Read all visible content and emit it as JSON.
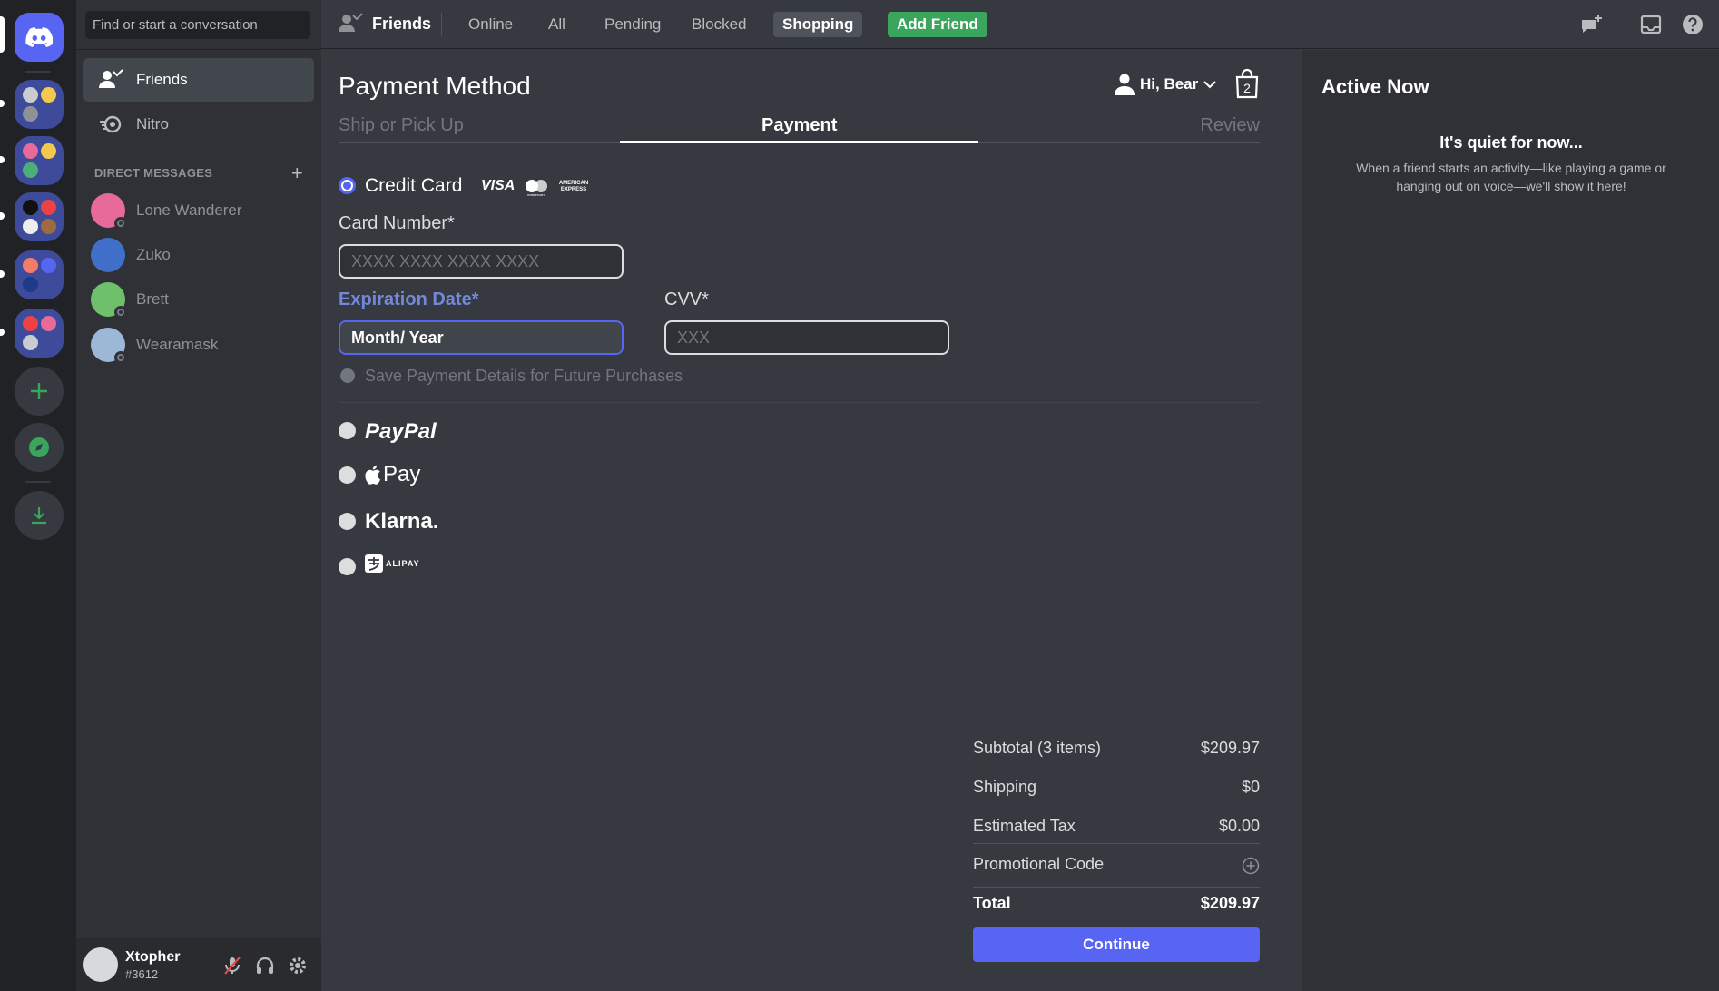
{
  "search": {
    "placeholder": "Find or start a conversation"
  },
  "sidebar": {
    "nav": [
      {
        "label": "Friends",
        "icon": "friends-icon"
      },
      {
        "label": "Nitro",
        "icon": "nitro-icon"
      }
    ],
    "dm_header": "DIRECT MESSAGES",
    "dms": [
      {
        "name": "Lone Wanderer",
        "avatar_color": "#e86a9a"
      },
      {
        "name": "Zuko",
        "avatar_color": "#3f6fc8"
      },
      {
        "name": "Brett",
        "avatar_color": "#6ec06a"
      },
      {
        "name": "Wearamask",
        "avatar_color": "#9db8d6"
      }
    ]
  },
  "user": {
    "name": "Xtopher",
    "tag": "#3612"
  },
  "header": {
    "title": "Friends",
    "tabs": [
      "Online",
      "All",
      "Pending",
      "Blocked",
      "Shopping"
    ],
    "active_tab": "Shopping",
    "add_friend": "Add Friend"
  },
  "checkout": {
    "title": "Payment Method",
    "greeting": "Hi, Bear",
    "bag_count": "2",
    "steps": [
      "Ship or Pick Up",
      "Payment",
      "Review"
    ],
    "current_step": "Payment",
    "credit_card": {
      "label": "Credit Card",
      "card_brands": [
        "VISA",
        "mastercard",
        "AMERICAN EXPRESS"
      ],
      "card_number_label": "Card Number*",
      "card_number_placeholder": "XXXX XXXX XXXX XXXX",
      "expiration_label": "Expiration Date*",
      "expiration_value": "Month/ Year",
      "cvv_label": "CVV*",
      "cvv_placeholder": "XXX",
      "save_label": "Save Payment Details for Future Purchases"
    },
    "other_methods": [
      "PayPal",
      "Pay",
      "Klarna.",
      "ALIPAY"
    ],
    "summary": [
      {
        "label": "Subtotal (3 items)",
        "value": "$209.97"
      },
      {
        "label": "Shipping",
        "value": "$0"
      },
      {
        "label": "Estimated Tax",
        "value": "$0.00"
      },
      {
        "label": "Promotional Code",
        "value": ""
      },
      {
        "label": "Total",
        "value": "$209.97"
      }
    ],
    "continue_label": "Continue"
  },
  "active_now": {
    "title": "Active Now",
    "quiet": "It's quiet for now...",
    "description": "When a friend starts an activity—like playing a game or hanging out on voice—we'll show it here!"
  },
  "colors": {
    "blurple": "#5865f2",
    "green": "#3ba55d",
    "bg": "#36393f",
    "sidebar": "#2f3136",
    "rail": "#202225"
  }
}
